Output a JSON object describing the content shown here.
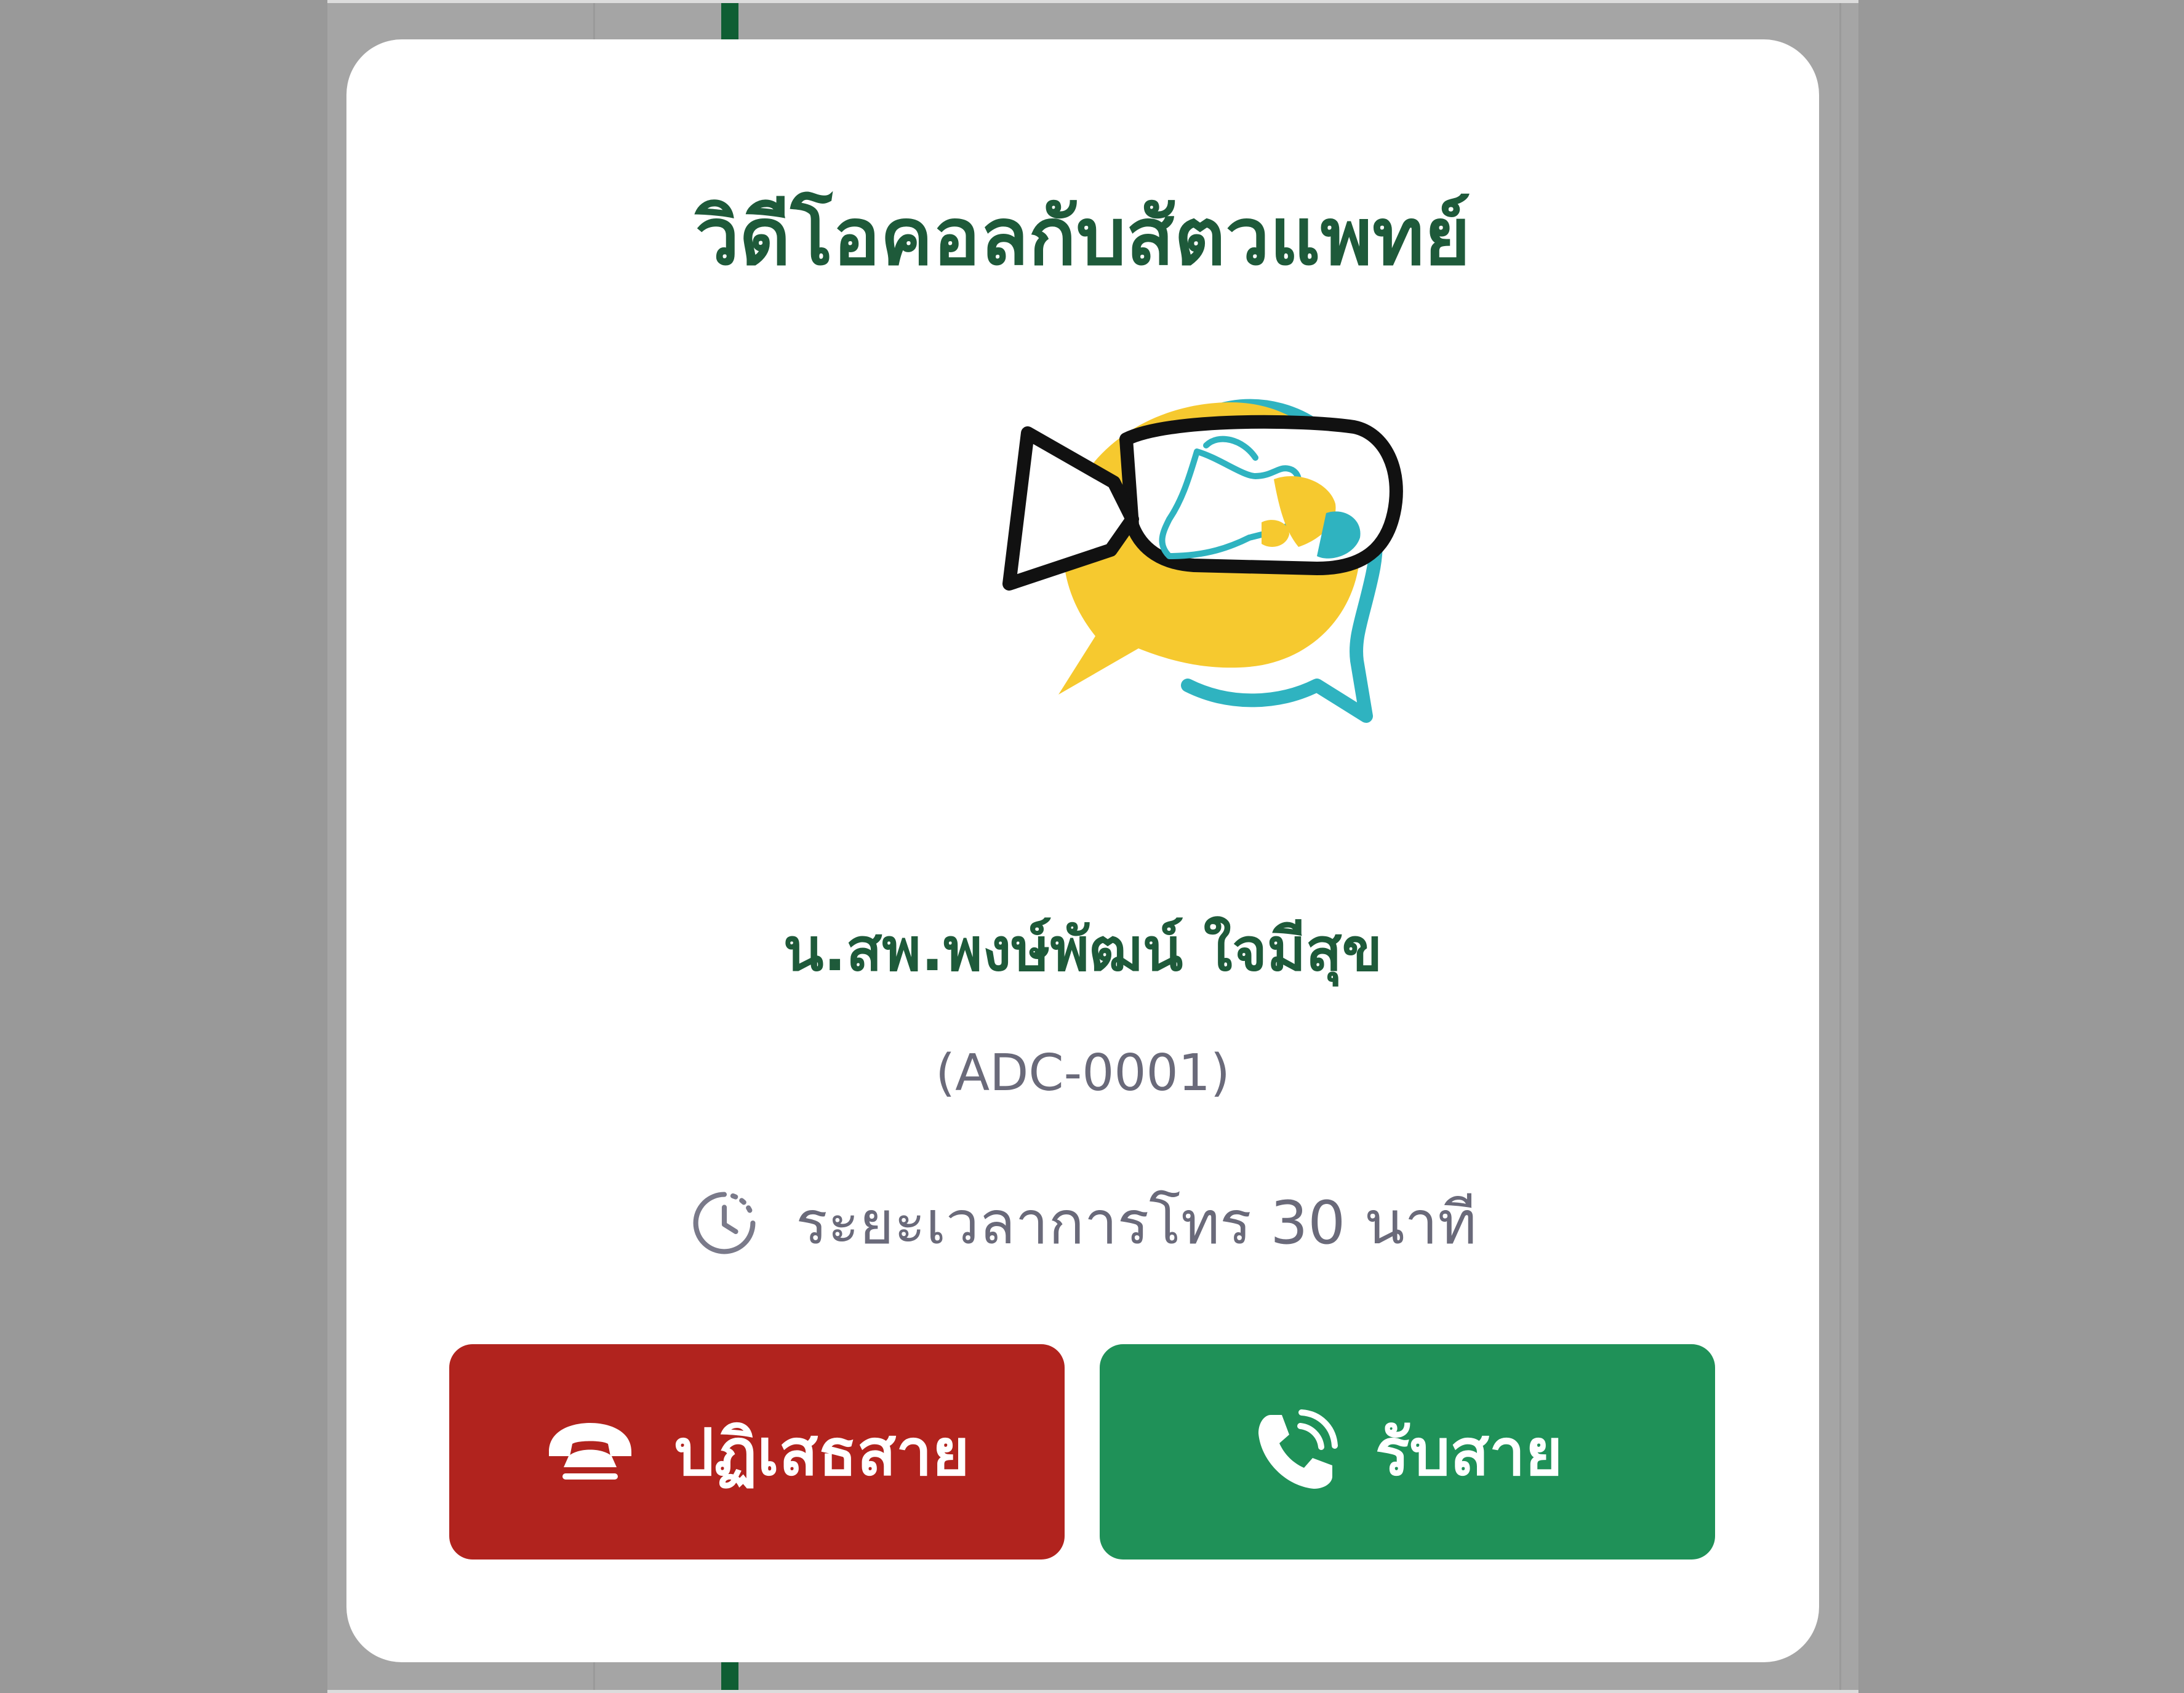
{
  "dialog": {
    "title": "วิดีโอคอลกับสัตวแพทย์",
    "logo_icon": "video-chat-cow-icon",
    "doctor_name": "น.สพ.พงษ์พัฒน์ ใจมีสุข",
    "doctor_code": "(ADC-0001)",
    "duration_icon": "clock-icon",
    "duration_text": "ระยะเวลาการโทร 30 นาที",
    "decline_button": {
      "label": "ปฏิเสธสาย",
      "icon": "hang-up-phone-icon",
      "color": "#b1231e"
    },
    "accept_button": {
      "label": "รับสาย",
      "icon": "phone-ringing-icon",
      "color": "#1f9158"
    }
  },
  "colors": {
    "title": "#1e5a3a",
    "muted_text": "#6a6a7a",
    "logo_yellow": "#f6c92f",
    "logo_teal": "#2fb3c0",
    "overlay": "#999999"
  }
}
